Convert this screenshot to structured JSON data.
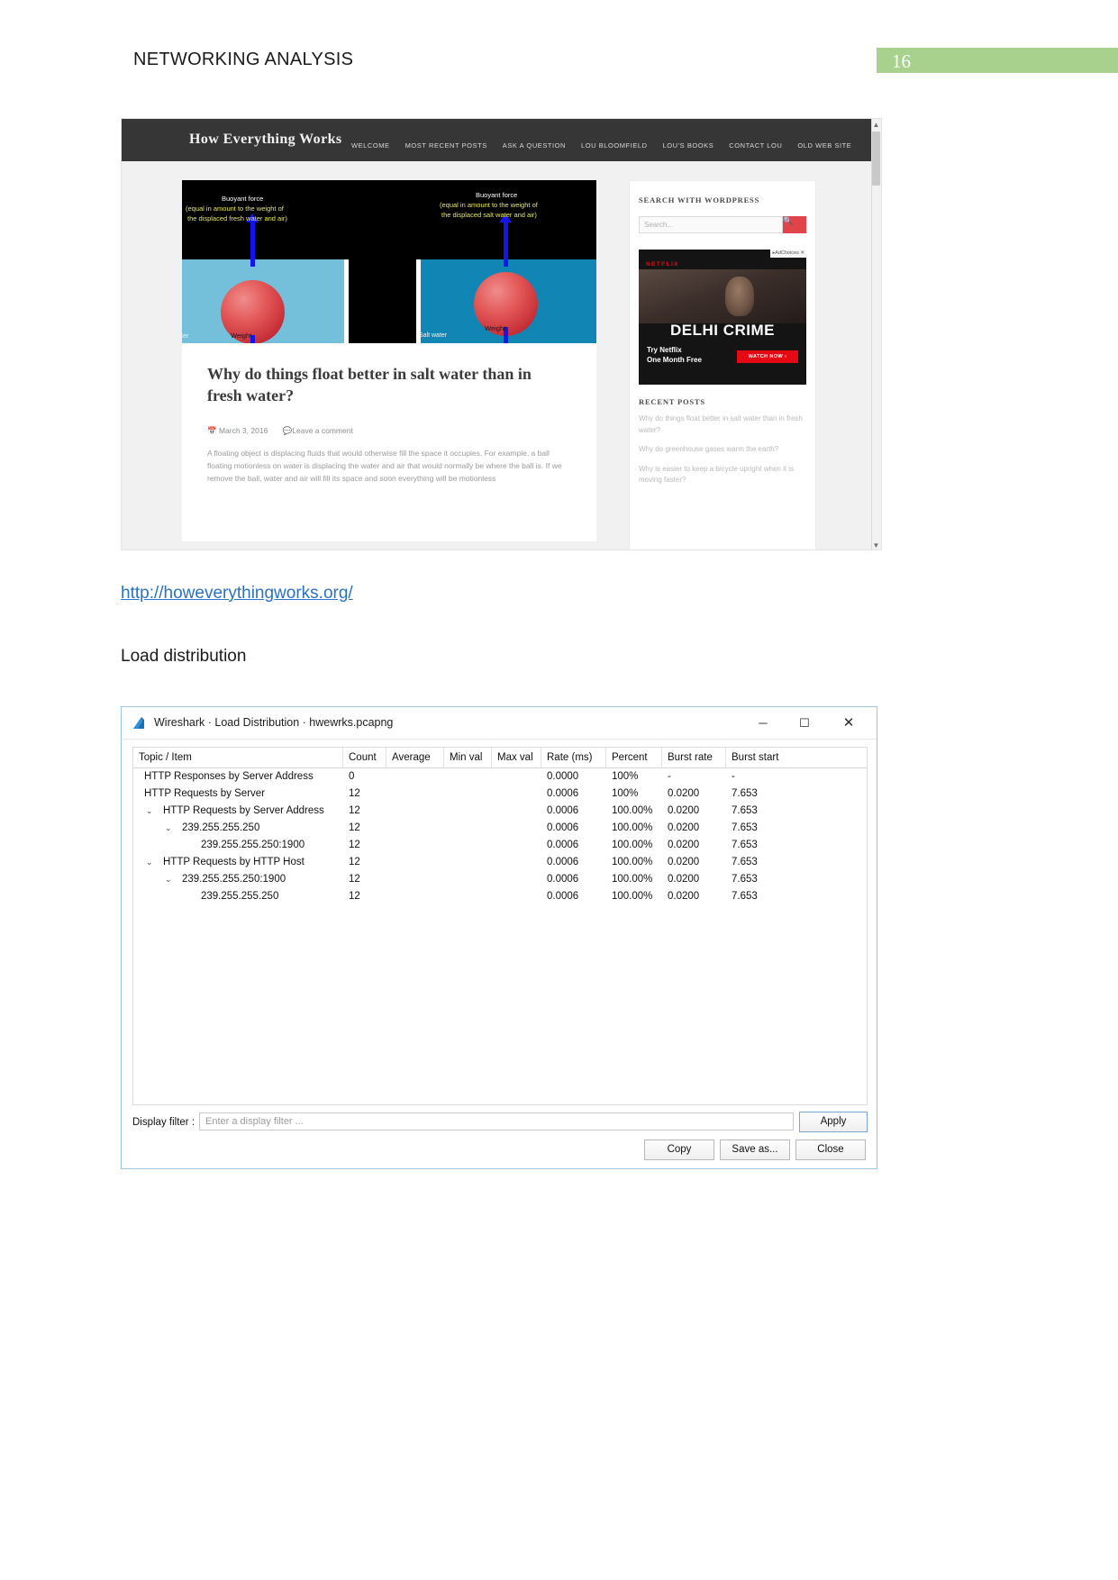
{
  "document": {
    "header_title": "NETWORKING ANALYSIS",
    "page_number": "16",
    "page_badge_color": "#a9d18e",
    "link_text": "http://howeverythingworks.org/",
    "link_color": "#2a72c4",
    "section_heading": "Load distribution"
  },
  "browser_screenshot": {
    "brand": "How Everything Works",
    "nav": [
      {
        "label": "WELCOME"
      },
      {
        "label": "MOST RECENT POSTS"
      },
      {
        "label": "ASK A QUESTION"
      },
      {
        "label": "LOU BLOOMFIELD"
      },
      {
        "label": "LOU'S BOOKS"
      },
      {
        "label": "CONTACT LOU"
      },
      {
        "label": "OLD WEB SITE"
      }
    ],
    "figure": {
      "left": {
        "force_label": "Buoyant force",
        "force_detail_line1": "(equal in amount to the weight of",
        "force_detail_line2": "the displaced fresh water and air)",
        "weight_label": "Weight",
        "water_label": "ter",
        "water_color": "#74c0da"
      },
      "right": {
        "force_label": "Buoyant force",
        "force_detail_line1": "(equal in amount to the weight of",
        "force_detail_line2": "the displaced salt water and air)",
        "weight_label": "Weight",
        "water_label": "Salt water",
        "water_color": "#1186b4"
      }
    },
    "article": {
      "title": "Why do things float better in salt water than in fresh water?",
      "date": "March 3, 2016",
      "comment_link": "Leave a comment",
      "body": "A floating object is displacing fluids that would otherwise fill the space it occupies. For example, a ball floating motionless on water is displacing the water and air that would normally be where the ball is. If we remove the ball, water and air will fill its space and soon everything will be motionless"
    },
    "sidebar": {
      "search_heading": "SEARCH WITH WORDPRESS",
      "search_placeholder": "Search...",
      "search_button_icon": "search-icon",
      "ad": {
        "choices_label": "AdChoices",
        "brand": "NETFLIX",
        "title": "DELHI CRIME",
        "subtitle_line1": "Try Netflix",
        "subtitle_line2": "One Month Free",
        "cta": "WATCH NOW   ›"
      },
      "recent_posts_heading": "RECENT POSTS",
      "recent_posts": [
        {
          "title": "Why do things float better in salt water than in fresh water?"
        },
        {
          "title": "Why do greenhouse gases warm the earth?"
        },
        {
          "title": "Why is easier to keep a bicycle upright when it is moving faster?"
        }
      ]
    }
  },
  "wireshark": {
    "title": "Wireshark · Load Distribution · hwewrks.pcapng",
    "window_buttons": {
      "minimize": "─",
      "maximize": "☐",
      "close": "✕"
    },
    "columns": [
      "Topic / Item",
      "Count",
      "Average",
      "Min val",
      "Max val",
      "Rate (ms)",
      "Percent",
      "Burst rate",
      "Burst start"
    ],
    "rows": [
      {
        "indent": 1,
        "twisty": "",
        "topic": "HTTP Responses by Server Address",
        "count": "0",
        "average": "",
        "min": "",
        "max": "",
        "rate": "0.0000",
        "percent": "100%",
        "burst_rate": "-",
        "burst_start": "-"
      },
      {
        "indent": 1,
        "twisty": "⌄",
        "topic": "HTTP Requests by Server",
        "count": "12",
        "average": "",
        "min": "",
        "max": "",
        "rate": "0.0006",
        "percent": "100%",
        "burst_rate": "0.0200",
        "burst_start": "7.653"
      },
      {
        "indent": 2,
        "twisty": "⌄",
        "topic": "HTTP Requests by Server Address",
        "count": "12",
        "average": "",
        "min": "",
        "max": "",
        "rate": "0.0006",
        "percent": "100.00%",
        "burst_rate": "0.0200",
        "burst_start": "7.653"
      },
      {
        "indent": 3,
        "twisty": "⌄",
        "topic": "239.255.255.250",
        "count": "12",
        "average": "",
        "min": "",
        "max": "",
        "rate": "0.0006",
        "percent": "100.00%",
        "burst_rate": "0.0200",
        "burst_start": "7.653"
      },
      {
        "indent": 4,
        "twisty": "",
        "topic": "239.255.255.250:1900",
        "count": "12",
        "average": "",
        "min": "",
        "max": "",
        "rate": "0.0006",
        "percent": "100.00%",
        "burst_rate": "0.0200",
        "burst_start": "7.653"
      },
      {
        "indent": 2,
        "twisty": "⌄",
        "topic": "HTTP Requests by HTTP Host",
        "count": "12",
        "average": "",
        "min": "",
        "max": "",
        "rate": "0.0006",
        "percent": "100.00%",
        "burst_rate": "0.0200",
        "burst_start": "7.653"
      },
      {
        "indent": 3,
        "twisty": "⌄",
        "topic": "239.255.255.250:1900",
        "count": "12",
        "average": "",
        "min": "",
        "max": "",
        "rate": "0.0006",
        "percent": "100.00%",
        "burst_rate": "0.0200",
        "burst_start": "7.653"
      },
      {
        "indent": 4,
        "twisty": "",
        "topic": "239.255.255.250",
        "count": "12",
        "average": "",
        "min": "",
        "max": "",
        "rate": "0.0006",
        "percent": "100.00%",
        "burst_rate": "0.0200",
        "burst_start": "7.653"
      }
    ],
    "display_filter_label": "Display filter :",
    "display_filter_placeholder": "Enter a display filter ...",
    "apply_button": "Apply",
    "copy_button": "Copy",
    "save_as_button": "Save as...",
    "close_button": "Close"
  }
}
